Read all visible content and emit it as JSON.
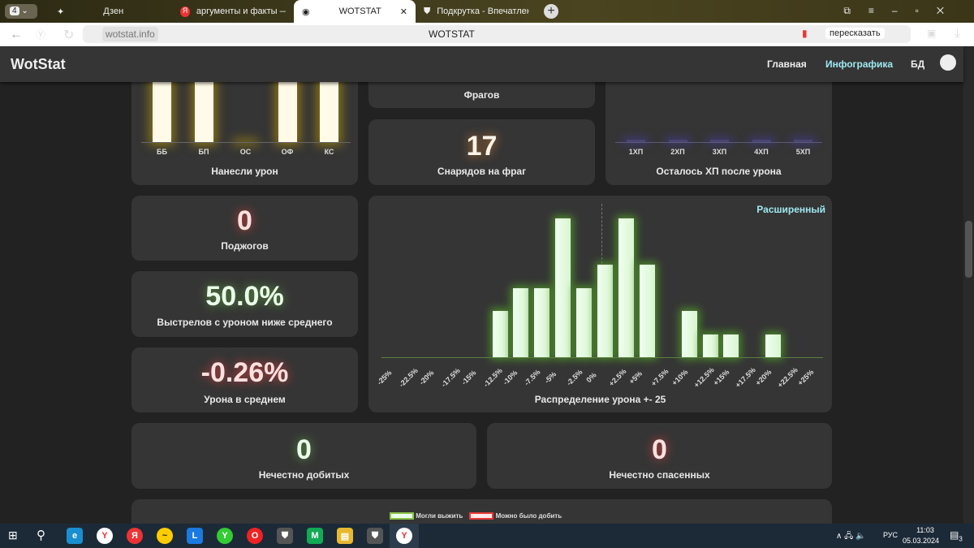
{
  "browser": {
    "tab_count": "4",
    "tabs": [
      {
        "label": "Дзен"
      },
      {
        "label": "аргументы и факты — Янд"
      },
      {
        "label": "WOTSTAT"
      },
      {
        "label": "Подкрутка - Впечатления"
      }
    ],
    "url": "wotstat.info",
    "page_title": "WOTSTAT",
    "retell_label": "пересказать"
  },
  "site": {
    "logo": "WotStat",
    "nav": [
      {
        "label": "Главная"
      },
      {
        "label": "Инфографика"
      },
      {
        "label": "БД"
      }
    ]
  },
  "cards": {
    "damage_dealt": {
      "title": "Нанесли урон",
      "categories": [
        "ББ",
        "БП",
        "ОС",
        "ОФ",
        "КС"
      ],
      "values": [
        1,
        1,
        0,
        1,
        1
      ]
    },
    "frags": {
      "title": "Фрагов"
    },
    "shells_per_frag": {
      "value": "17",
      "title": "Снарядов на фраг"
    },
    "hp_left": {
      "title": "Осталось ХП после урона",
      "categories": [
        "1ХП",
        "2ХП",
        "3ХП",
        "4ХП",
        "5ХП"
      ],
      "values": [
        0,
        0,
        0,
        0,
        0
      ]
    },
    "fires": {
      "value": "0",
      "title": "Поджогов"
    },
    "below_avg": {
      "value": "50.0%",
      "title": "Выстрелов с уроном ниже среднего"
    },
    "avg_damage": {
      "value": "-0.26%",
      "title": "Урона в среднем"
    },
    "unfair_kills": {
      "value": "0",
      "title": "Нечестно добитых"
    },
    "unfair_saves": {
      "value": "0",
      "title": "Нечестно спасенных"
    },
    "legend": [
      {
        "label": "Могли выжить",
        "color": "#8bc34a"
      },
      {
        "label": "Можно было добить",
        "color": "#e53935"
      }
    ]
  },
  "chart_data": {
    "type": "bar",
    "title": "Распределение урона +- 25",
    "toggle": "Расширенный",
    "categories": [
      "-25%",
      "-22.5%",
      "-20%",
      "-17.5%",
      "-15%",
      "-12.5%",
      "-10%",
      "-7.5%",
      "-5%",
      "-2.5%",
      "0%",
      "+2.5%",
      "+5%",
      "+7.5%",
      "+10%",
      "+12.5%",
      "+15%",
      "+17.5%",
      "+20%",
      "+22.5%",
      "+25%"
    ],
    "values": [
      0,
      0,
      0,
      0,
      0,
      2,
      3,
      3,
      6,
      3,
      4,
      6,
      4,
      0,
      2,
      1,
      1,
      0,
      1,
      0,
      0
    ],
    "ylim": [
      0,
      6
    ],
    "color": "#e6ffe0"
  },
  "taskbar": {
    "lang": "РУС",
    "time": "11:03",
    "date": "05.03.2024",
    "notif": "3"
  }
}
